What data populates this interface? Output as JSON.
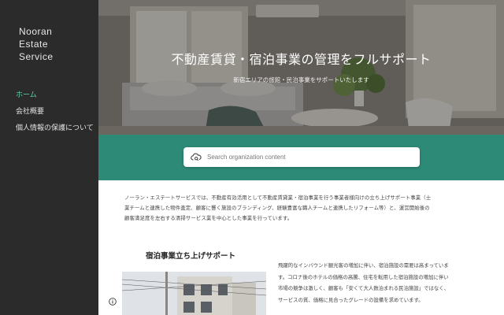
{
  "brand": {
    "line1": "Nooran",
    "line2": "Estate",
    "line3": "Service"
  },
  "nav": {
    "items": [
      {
        "label": "ホーム",
        "active": true
      },
      {
        "label": "会社概要",
        "active": false
      },
      {
        "label": "個人情報の保護について",
        "active": false
      }
    ]
  },
  "hero": {
    "title": "不動産賃貸・宿泊事業の管理をフルサポート",
    "subtitle": "新宿エリアの旅館・民泊事業をサポートいたします"
  },
  "search": {
    "placeholder": "Search organization content",
    "icon": "cloud-search-icon"
  },
  "intro": {
    "line1": "ノーラン・エステートサービスでは、不動産有効活用として不動産賃貸業・宿泊事業を行う事業者様向けの立ち上げサポート事業（士",
    "line2": "業チームと連携した物件査定、顧客に響く施設のブランディング、経験豊富な職人チームと連携したリフォーム等）と、運営開始後の",
    "line3": "顧客満足度を左右する清掃サービス業を中心とした事業を行っています。"
  },
  "section": {
    "title": "宿泊事業立ち上げサポート",
    "line1": "飛躍的なインバウンド観光客の増加に伴い、宿泊施設の需要は高まっていま",
    "line2": "す。コロナ後のホテルの価格の高騰、住宅を転用した宿泊施設の増加に伴い",
    "line3": "市場の競争は激しく、顧客も「安くて大人数泊まれる民泊施設」ではなく、",
    "line4": "サービスの質、価格に見合ったグレードの設備を求めています。"
  },
  "colors": {
    "sidebar": "#2b2b2b",
    "accent": "#5fd3a6",
    "band": "#2d8a77"
  }
}
